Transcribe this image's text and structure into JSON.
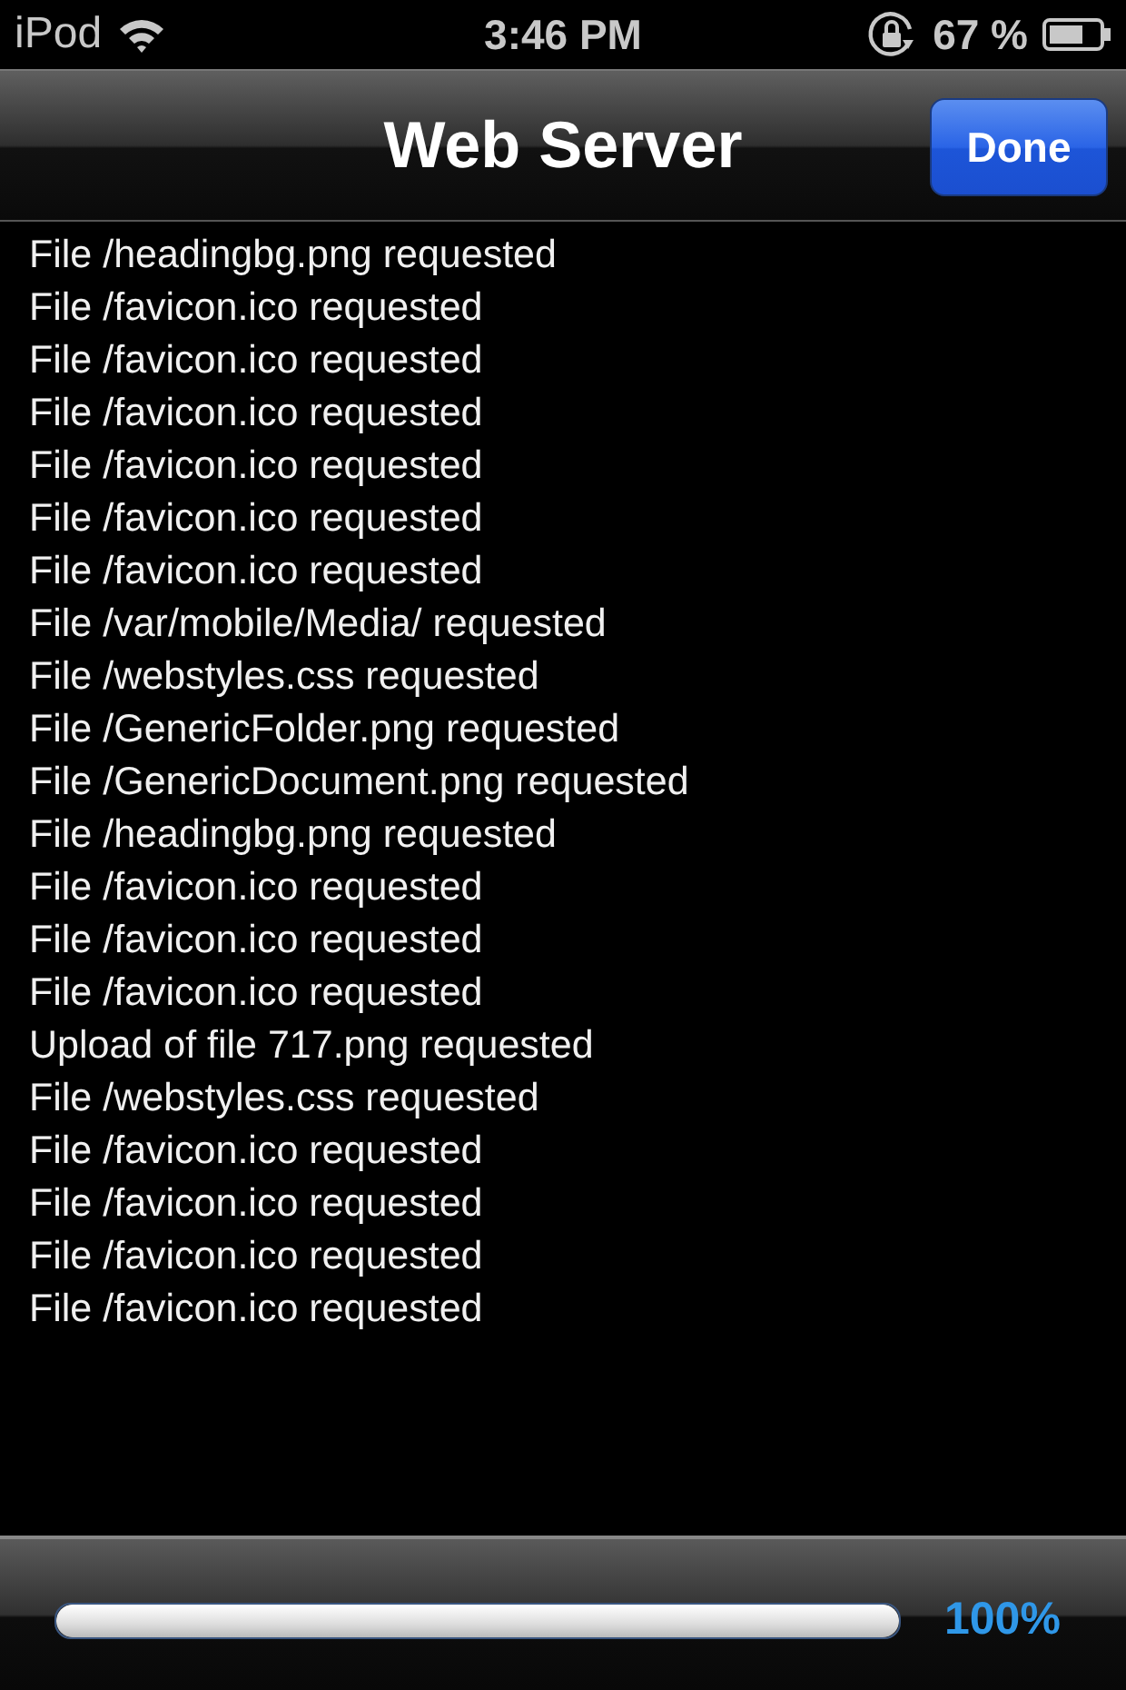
{
  "status_bar": {
    "carrier": "iPod",
    "time": "3:46 PM",
    "battery": "67 %"
  },
  "nav_bar": {
    "title": "Web Server",
    "done_button": "Done"
  },
  "log": [
    "File /headingbg.png requested",
    "File /favicon.ico requested",
    "File /favicon.ico requested",
    "File /favicon.ico requested",
    "File /favicon.ico requested",
    "File /favicon.ico requested",
    "File /favicon.ico requested",
    "File /var/mobile/Media/ requested",
    "File /webstyles.css requested",
    "File /GenericFolder.png requested",
    "File /GenericDocument.png requested",
    "File /headingbg.png requested",
    "File /favicon.ico requested",
    "File /favicon.ico requested",
    "File /favicon.ico requested",
    "Upload of file 717.png requested",
    "File /webstyles.css requested",
    "File /favicon.ico requested",
    "File /favicon.ico requested",
    "File /favicon.ico requested",
    "File /favicon.ico requested"
  ],
  "progress": {
    "level": 1,
    "reading": "100%"
  }
}
